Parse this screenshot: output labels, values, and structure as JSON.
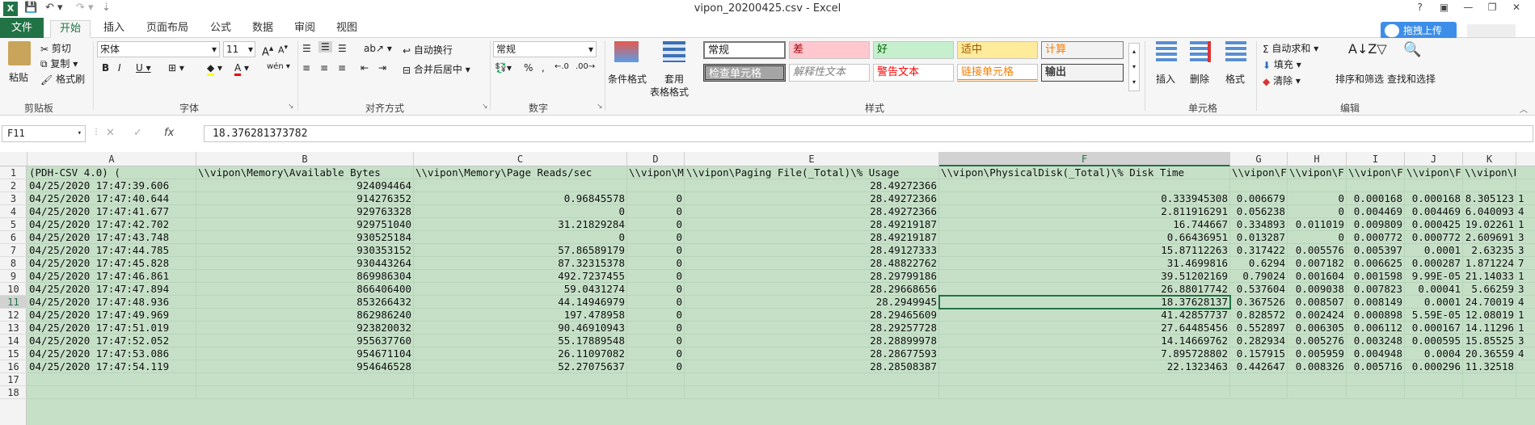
{
  "window": {
    "title": "vipon_20200425.csv - Excel",
    "controls": [
      "?",
      "▣",
      "—",
      "❐",
      "✕"
    ]
  },
  "tabs": [
    "文件",
    "开始",
    "插入",
    "页面布局",
    "公式",
    "数据",
    "审阅",
    "视图"
  ],
  "upload_label": "拖拽上传",
  "ribbon": {
    "clipboard": {
      "paste": "粘贴",
      "cut": "剪切",
      "copy": "复制",
      "format_painter": "格式刷",
      "label": "剪贴板"
    },
    "font": {
      "name": "宋体",
      "size": "11",
      "label": "字体"
    },
    "alignment": {
      "wrap": "自动换行",
      "merge": "合并后居中",
      "label": "对齐方式"
    },
    "number": {
      "format": "常规",
      "label": "数字"
    },
    "styles": {
      "conditional": "条件格式",
      "table_format_1": "套用",
      "table_format_2": "表格格式",
      "cells": [
        "常规",
        "差",
        "好",
        "适中",
        "计算",
        "检查单元格",
        "解释性文本",
        "警告文本",
        "链接单元格",
        "输出"
      ],
      "label": "样式"
    },
    "cells_group": {
      "insert": "插入",
      "delete": "删除",
      "format": "格式",
      "label": "单元格"
    },
    "editing": {
      "autosum": "自动求和",
      "fill": "填充",
      "clear": "清除",
      "sort": "排序和筛选",
      "find": "查找和选择",
      "label": "编辑"
    }
  },
  "formula_bar": {
    "name_box": "F11",
    "cancel": "✕",
    "enter": "✓",
    "fx": "fx",
    "formula": "18.376281373782"
  },
  "sheet": {
    "columns": [
      "A",
      "B",
      "C",
      "D",
      "E",
      "F",
      "G",
      "H",
      "I",
      "J",
      "K"
    ],
    "selected_column": "F",
    "selected_row": "11",
    "row_numbers": [
      "1",
      "2",
      "3",
      "4",
      "5",
      "6",
      "7",
      "8",
      "9",
      "10",
      "11",
      "12",
      "13",
      "14",
      "15",
      "16",
      "17",
      "18"
    ],
    "rows": [
      [
        "(PDH-CSV 4.0) (",
        "\\\\vipon\\Memory\\Available Bytes",
        "\\\\vipon\\Memory\\Page Reads/sec",
        "\\\\vipon\\M",
        "\\\\vipon\\Paging File(_Total)\\% Usage",
        "\\\\vipon\\PhysicalDisk(_Total)\\% Disk Time",
        "\\\\vipon\\F",
        "\\\\vipon\\F",
        "\\\\vipon\\F",
        "\\\\vipon\\F",
        "\\\\vipon\\F"
      ],
      [
        "04/25/2020 17:47:39.606",
        "924094464",
        "",
        "",
        "28.49272366",
        "",
        "",
        "",
        "",
        "",
        ""
      ],
      [
        "04/25/2020 17:47:40.644",
        "914276352",
        "0.96845578",
        "0",
        "28.49272366",
        "0.333945308",
        "0.006679",
        "0",
        "0.000168",
        "0.000168",
        "8.305123"
      ],
      [
        "04/25/2020 17:47:41.677",
        "929763328",
        "0",
        "0",
        "28.49272366",
        "2.811916291",
        "0.056238",
        "0",
        "0.004469",
        "0.004469",
        "6.040093"
      ],
      [
        "04/25/2020 17:47:42.702",
        "929751040",
        "31.21829284",
        "0",
        "28.49219187",
        "16.744667",
        "0.334893",
        "0.011019",
        "0.009809",
        "0.000425",
        "19.02261"
      ],
      [
        "04/25/2020 17:47:43.748",
        "930525184",
        "0",
        "0",
        "28.49219187",
        "0.66436951",
        "0.013287",
        "0",
        "0.000772",
        "0.000772",
        "2.609691"
      ],
      [
        "04/25/2020 17:47:44.785",
        "930353152",
        "57.86589179",
        "0",
        "28.49127333",
        "15.87112263",
        "0.317422",
        "0.005576",
        "0.005397",
        "0.0001",
        "2.63235"
      ],
      [
        "04/25/2020 17:47:45.828",
        "930443264",
        "87.32315378",
        "0",
        "28.48822762",
        "31.4699816",
        "0.6294",
        "0.007182",
        "0.006625",
        "0.000287",
        "1.871224"
      ],
      [
        "04/25/2020 17:47:46.861",
        "869986304",
        "492.7237455",
        "0",
        "28.29799186",
        "39.51202169",
        "0.79024",
        "0.001604",
        "0.001598",
        "9.99E-05",
        "21.14033"
      ],
      [
        "04/25/2020 17:47:47.894",
        "866406400",
        "59.0431274",
        "0",
        "28.29668656",
        "26.88017742",
        "0.537604",
        "0.009038",
        "0.007823",
        "0.00041",
        "5.66259"
      ],
      [
        "04/25/2020 17:47:48.936",
        "853266432",
        "44.14946979",
        "0",
        "28.2949945",
        "18.37628137",
        "0.367526",
        "0.008507",
        "0.008149",
        "0.0001",
        "24.70019"
      ],
      [
        "04/25/2020 17:47:49.969",
        "862986240",
        "197.478958",
        "0",
        "28.29465609",
        "41.42857737",
        "0.828572",
        "0.002424",
        "0.000898",
        "5.59E-05",
        "12.08019"
      ],
      [
        "04/25/2020 17:47:51.019",
        "923820032",
        "90.46910943",
        "0",
        "28.29257728",
        "27.64485456",
        "0.552897",
        "0.006305",
        "0.006112",
        "0.000167",
        "14.11296"
      ],
      [
        "04/25/2020 17:47:52.052",
        "955637760",
        "55.17889548",
        "0",
        "28.28899978",
        "14.14669762",
        "0.282934",
        "0.005276",
        "0.003248",
        "0.000595",
        "15.85525"
      ],
      [
        "04/25/2020 17:47:53.086",
        "954671104",
        "26.11097082",
        "0",
        "28.28677593",
        "7.895728802",
        "0.157915",
        "0.005959",
        "0.004948",
        "0.0004",
        "20.36559"
      ],
      [
        "04/25/2020 17:47:54.119",
        "954646528",
        "52.27075637",
        "0",
        "28.28508387",
        "22.1323463",
        "0.442647",
        "0.008326",
        "0.005716",
        "0.000296",
        "11.32518"
      ],
      [
        "",
        "",
        "",
        "",
        "",
        "",
        "",
        "",
        "",
        "",
        ""
      ],
      [
        "",
        "",
        "",
        "",
        "",
        "",
        "",
        "",
        "",
        "",
        ""
      ]
    ],
    "overflow_col_l": [
      "",
      "",
      "1",
      "4",
      "1",
      "3",
      "3",
      "7",
      "1",
      "3",
      "4",
      "1",
      "1",
      "3",
      "4",
      "",
      "",
      ""
    ]
  }
}
